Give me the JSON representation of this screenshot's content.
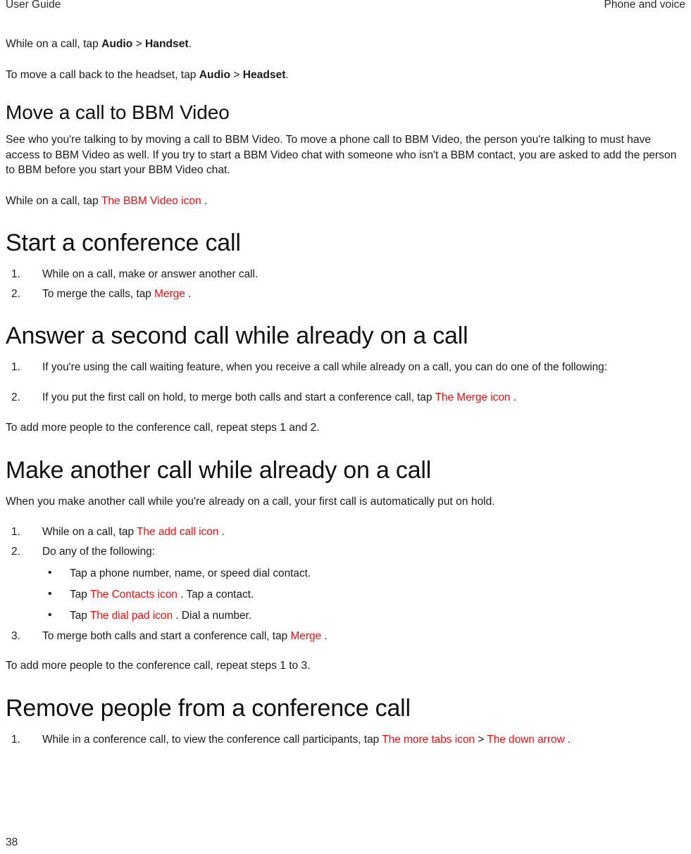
{
  "header": {
    "left": "User Guide",
    "right": "Phone and voice"
  },
  "footer": {
    "page_number": "38"
  },
  "colors": {
    "ui_reference_red": "#f40f0f",
    "body_text": "#1a1a1a",
    "heading_text": "#111111",
    "background": "#ffffff"
  },
  "intro": {
    "p1_pre": "While on a call, tap ",
    "p1_bold1": "Audio",
    "p1_sep": " > ",
    "p1_bold2": "Handset",
    "p1_post": ".",
    "p2_pre": "To move a call back to the headset, tap ",
    "p2_bold1": "Audio",
    "p2_sep": " > ",
    "p2_bold2": "Headset",
    "p2_post": "."
  },
  "sections": [
    {
      "id": "move-call-bbm-video",
      "level": "h2",
      "title": "Move a call to BBM Video",
      "body": "See who you're talking to by moving a call to BBM Video. To move a phone call to BBM Video, the person you're talking to must have access to BBM Video as well. If you try to start a BBM Video chat with someone who isn't a BBM contact, you are asked to add the person to BBM before you start your BBM Video chat.",
      "instruction_pre": "While on a call, tap ",
      "instruction_icon": "The BBM Video icon",
      "instruction_post": " ."
    },
    {
      "id": "start-conference-call",
      "level": "h1",
      "title": "Start a conference call",
      "step1": "While on a call, make or answer another call.",
      "step2_pre": "To merge the calls, tap ",
      "step2_icon": "Merge",
      "step2_post": " ."
    },
    {
      "id": "answer-second-call",
      "level": "h1",
      "title": "Answer a second call while already on a call",
      "step1": "If you're using the call waiting feature, when you receive a call while already on a call, you can do one of the following:",
      "step2_pre": "If you put the first call on hold, to merge both calls and start a conference call, tap ",
      "step2_icon": "The Merge icon",
      "step2_post": " .",
      "closing": "To add more people to the conference call, repeat steps 1 and 2."
    },
    {
      "id": "make-another-call",
      "level": "h1",
      "title": "Make another call while already on a call",
      "body": "When you make another call while you're already on a call, your first call is automatically put on hold.",
      "step1_pre": "While on a call, tap ",
      "step1_icon": "The add call icon",
      "step1_post": " .",
      "step2": "Do any of the following:",
      "bullets": [
        {
          "pre": " Tap a phone number, name, or speed dial contact.",
          "icon": "",
          "post": ""
        },
        {
          "pre": "Tap ",
          "icon": "The Contacts icon",
          "post": " . Tap a contact."
        },
        {
          "pre": "Tap ",
          "icon": "The dial pad icon",
          "post": " . Dial a number."
        }
      ],
      "step3_pre": "To merge both calls and start a conference call, tap ",
      "step3_icon": "Merge",
      "step3_post": " .",
      "closing": "To add more people to the conference call, repeat steps 1 to 3."
    },
    {
      "id": "remove-people-conference",
      "level": "h1",
      "title": "Remove people from a conference call",
      "step1_pre": "While in a conference call, to view the conference call participants, tap ",
      "step1_icon1": "The more tabs icon",
      "step1_sep": " > ",
      "step1_icon2": "The down arrow",
      "step1_post": " ."
    }
  ]
}
